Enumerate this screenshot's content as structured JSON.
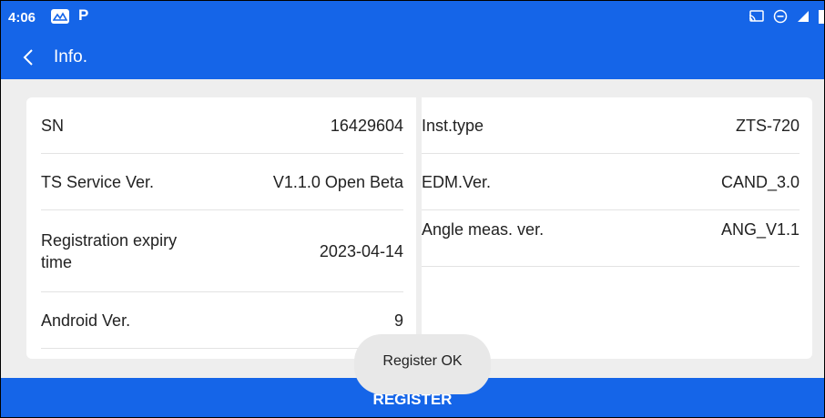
{
  "status_bar": {
    "time": "4:06"
  },
  "app_bar": {
    "title": "Info."
  },
  "info": {
    "left": [
      {
        "label": "SN",
        "value": "16429604"
      },
      {
        "label": "TS Service Ver.",
        "value": "V1.1.0 Open Beta"
      },
      {
        "label": "Registration expiry time",
        "value": "2023-04-14"
      },
      {
        "label": "Android Ver.",
        "value": "9"
      }
    ],
    "right": [
      {
        "label": "Inst.type",
        "value": "ZTS-720"
      },
      {
        "label": "EDM.Ver.",
        "value": "CAND_3.0"
      },
      {
        "label": "Angle meas. ver.",
        "value": "ANG_V1.1"
      }
    ]
  },
  "toast": {
    "text": "Register OK"
  },
  "footer": {
    "register_label": "REGISTER"
  },
  "colors": {
    "primary": "#1565e8",
    "background": "#eeeeee",
    "card": "#ffffff",
    "toast": "#e8e8e8"
  },
  "icons": {
    "status_left": [
      "gallery-icon",
      "parking-app-icon"
    ],
    "status_right": [
      "cast-icon",
      "do-not-disturb-icon",
      "signal-icon",
      "battery-icon"
    ],
    "app_bar": [
      "back-arrow-icon"
    ]
  }
}
